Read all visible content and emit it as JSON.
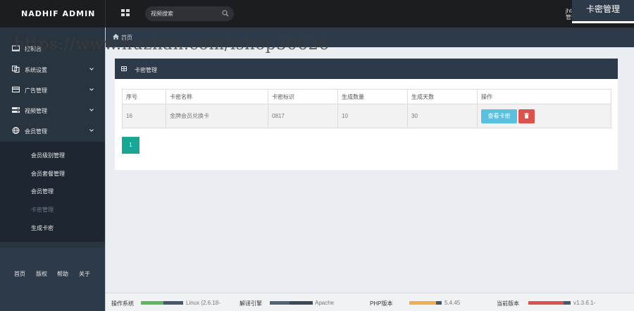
{
  "brand": "NADHIF ADMIN",
  "search": {
    "placeholder": "视频搜索"
  },
  "user": {
    "name": "jht338339",
    "role": "管理员"
  },
  "sidebar": {
    "items": [
      {
        "label": "控制台",
        "icon": "desktop-icon"
      },
      {
        "label": "系统设置",
        "icon": "copy-icon"
      },
      {
        "label": "广告管理",
        "icon": "card-icon"
      },
      {
        "label": "视频管理",
        "icon": "server-icon"
      },
      {
        "label": "会员管理",
        "icon": "globe-icon"
      }
    ],
    "submenu": [
      {
        "label": "会员级别管理"
      },
      {
        "label": "会员套餐管理"
      },
      {
        "label": "会员管理"
      },
      {
        "label": "卡密管理",
        "active": true
      },
      {
        "label": "生成卡密"
      }
    ],
    "footer": [
      "首页",
      "版权",
      "帮助",
      "关于"
    ]
  },
  "breadcrumb": {
    "home": "首页",
    "title": "卡密管理"
  },
  "watermark": "https://www.huzhan.com/ishop30626",
  "panel": {
    "title": "卡密管理",
    "table": {
      "headers": [
        "序号",
        "卡密名称",
        "卡密标识",
        "生成数量",
        "生成天数",
        "操作"
      ],
      "rows": [
        {
          "id": "16",
          "name": "金牌会员兑换卡",
          "code": "0817",
          "count": "10",
          "days": "30"
        }
      ]
    },
    "view_button": "查看卡密",
    "pagination": {
      "current": "1"
    }
  },
  "status_bar": {
    "items": [
      {
        "label": "操作系统",
        "value": "Linux (2.6.18-",
        "color": "#5cb85c"
      },
      {
        "label": "解译引擎",
        "value": "Apache",
        "color": "#46596a"
      },
      {
        "label": "PHP版本",
        "value": "5.4.45",
        "color": "#f0ad4e"
      },
      {
        "label": "当前版本",
        "value": "v1.3.6.1-",
        "color": "#d9534f"
      }
    ]
  },
  "colors": {
    "topbar": "#1b1d20",
    "sidebar": "#293441",
    "header_dark": "#2d3a4a",
    "accent_teal": "#1aa694",
    "info": "#5bc0de",
    "danger": "#d9534f"
  }
}
